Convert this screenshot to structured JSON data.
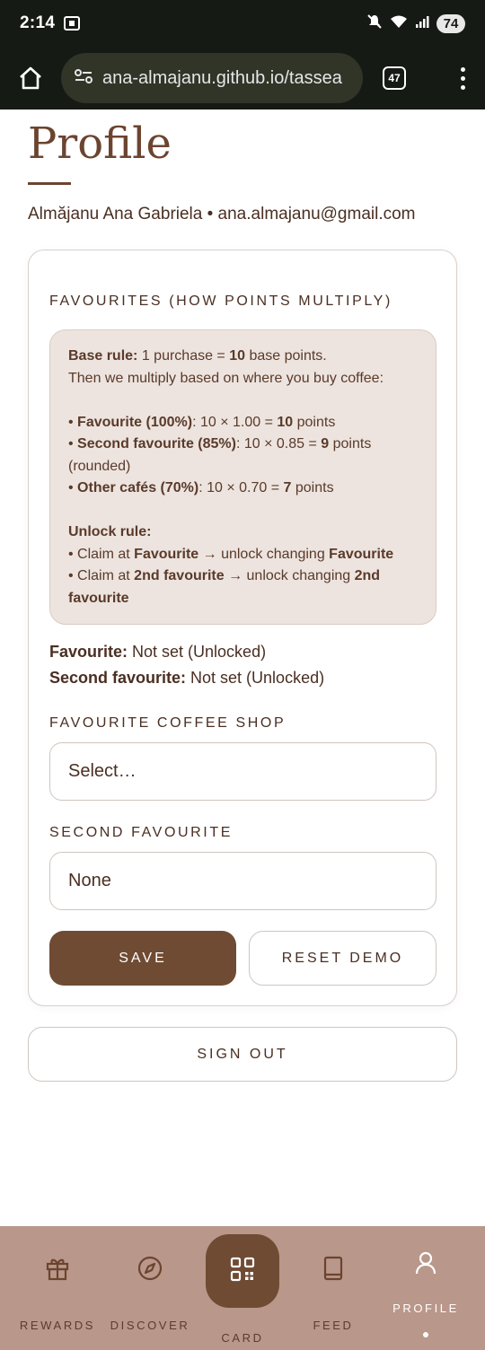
{
  "status_bar": {
    "time": "2:14",
    "battery": "74"
  },
  "browser": {
    "url": "ana-almajanu.github.io/tassea",
    "tab_count": "47"
  },
  "page": {
    "title": "Profile",
    "user_line": "Almăjanu Ana Gabriela • ana.almajanu@gmail.com"
  },
  "favourites": {
    "section_label": "FAVOURITES (HOW POINTS MULTIPLY)",
    "base_rule_label": "Base rule:",
    "base_rule_text_1": " 1 purchase = ",
    "base_rule_points": "10",
    "base_rule_text_2": " base points.",
    "multiply_intro": "Then we multiply based on where you buy coffee:",
    "rule_fav_label": "Favourite (100%)",
    "rule_fav_calc": ": 10 × 1.00 = ",
    "rule_fav_points": "10",
    "rule_fav_suffix": " points",
    "rule_second_label": "Second favourite (85%)",
    "rule_second_calc": ": 10 × 0.85 = ",
    "rule_second_points": "9",
    "rule_second_suffix": " points (rounded)",
    "rule_other_label": "Other cafés (70%)",
    "rule_other_calc": ": 10 × 0.70 = ",
    "rule_other_points": "7",
    "rule_other_suffix": " points",
    "unlock_label": "Unlock rule:",
    "unlock_1_a": "Claim at ",
    "unlock_1_b": "Favourite",
    "unlock_1_c": " → unlock changing ",
    "unlock_1_d": "Favourite",
    "unlock_2_a": "Claim at ",
    "unlock_2_b": "2nd favourite",
    "unlock_2_c": " → unlock changing ",
    "unlock_2_d": "2nd favourite",
    "bullet": "• ",
    "favourite_status_label": "Favourite:",
    "favourite_status_value": " Not set (Unlocked)",
    "second_status_label": "Second favourite:",
    "second_status_value": " Not set (Unlocked)",
    "fav_shop_label": "FAVOURITE COFFEE SHOP",
    "fav_shop_value": "Select…",
    "second_label": "SECOND FAVOURITE",
    "second_value": "None",
    "save_label": "SAVE",
    "reset_label": "RESET DEMO"
  },
  "sign_out_label": "SIGN OUT",
  "nav": {
    "rewards": "REWARDS",
    "discover": "DISCOVER",
    "card": "CARD",
    "feed": "FEED",
    "profile": "PROFILE"
  }
}
